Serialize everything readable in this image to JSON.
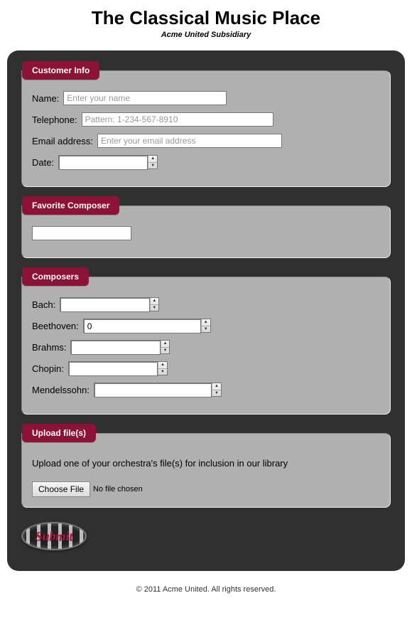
{
  "header": {
    "title": "The Classical Music Place",
    "subtitle": "Acme United Subsidiary"
  },
  "customer": {
    "legend": "Customer Info",
    "name_label": "Name:",
    "name_placeholder": "Enter your name",
    "tel_label": "Telephone:",
    "tel_placeholder": "Pattern: 1-234-567-8910",
    "email_label": "Email address:",
    "email_placeholder": "Enter your email address",
    "date_label": "Date:",
    "date_value": ""
  },
  "favorite": {
    "legend": "Favorite Composer",
    "value": ""
  },
  "composers": {
    "legend": "Composers",
    "items": [
      {
        "label": "Bach:",
        "value": ""
      },
      {
        "label": "Beethoven:",
        "value": "0"
      },
      {
        "label": "Brahms:",
        "value": ""
      },
      {
        "label": "Chopin:",
        "value": ""
      },
      {
        "label": "Mendelssohn:",
        "value": ""
      }
    ]
  },
  "upload": {
    "legend": "Upload file(s)",
    "description": "Upload one of your orchestra's file(s) for inclusion in our library",
    "choose_label": "Choose File",
    "status": "No file chosen"
  },
  "submit_label": "Submit",
  "footer": "© 2011 Acme United. All rights reserved."
}
